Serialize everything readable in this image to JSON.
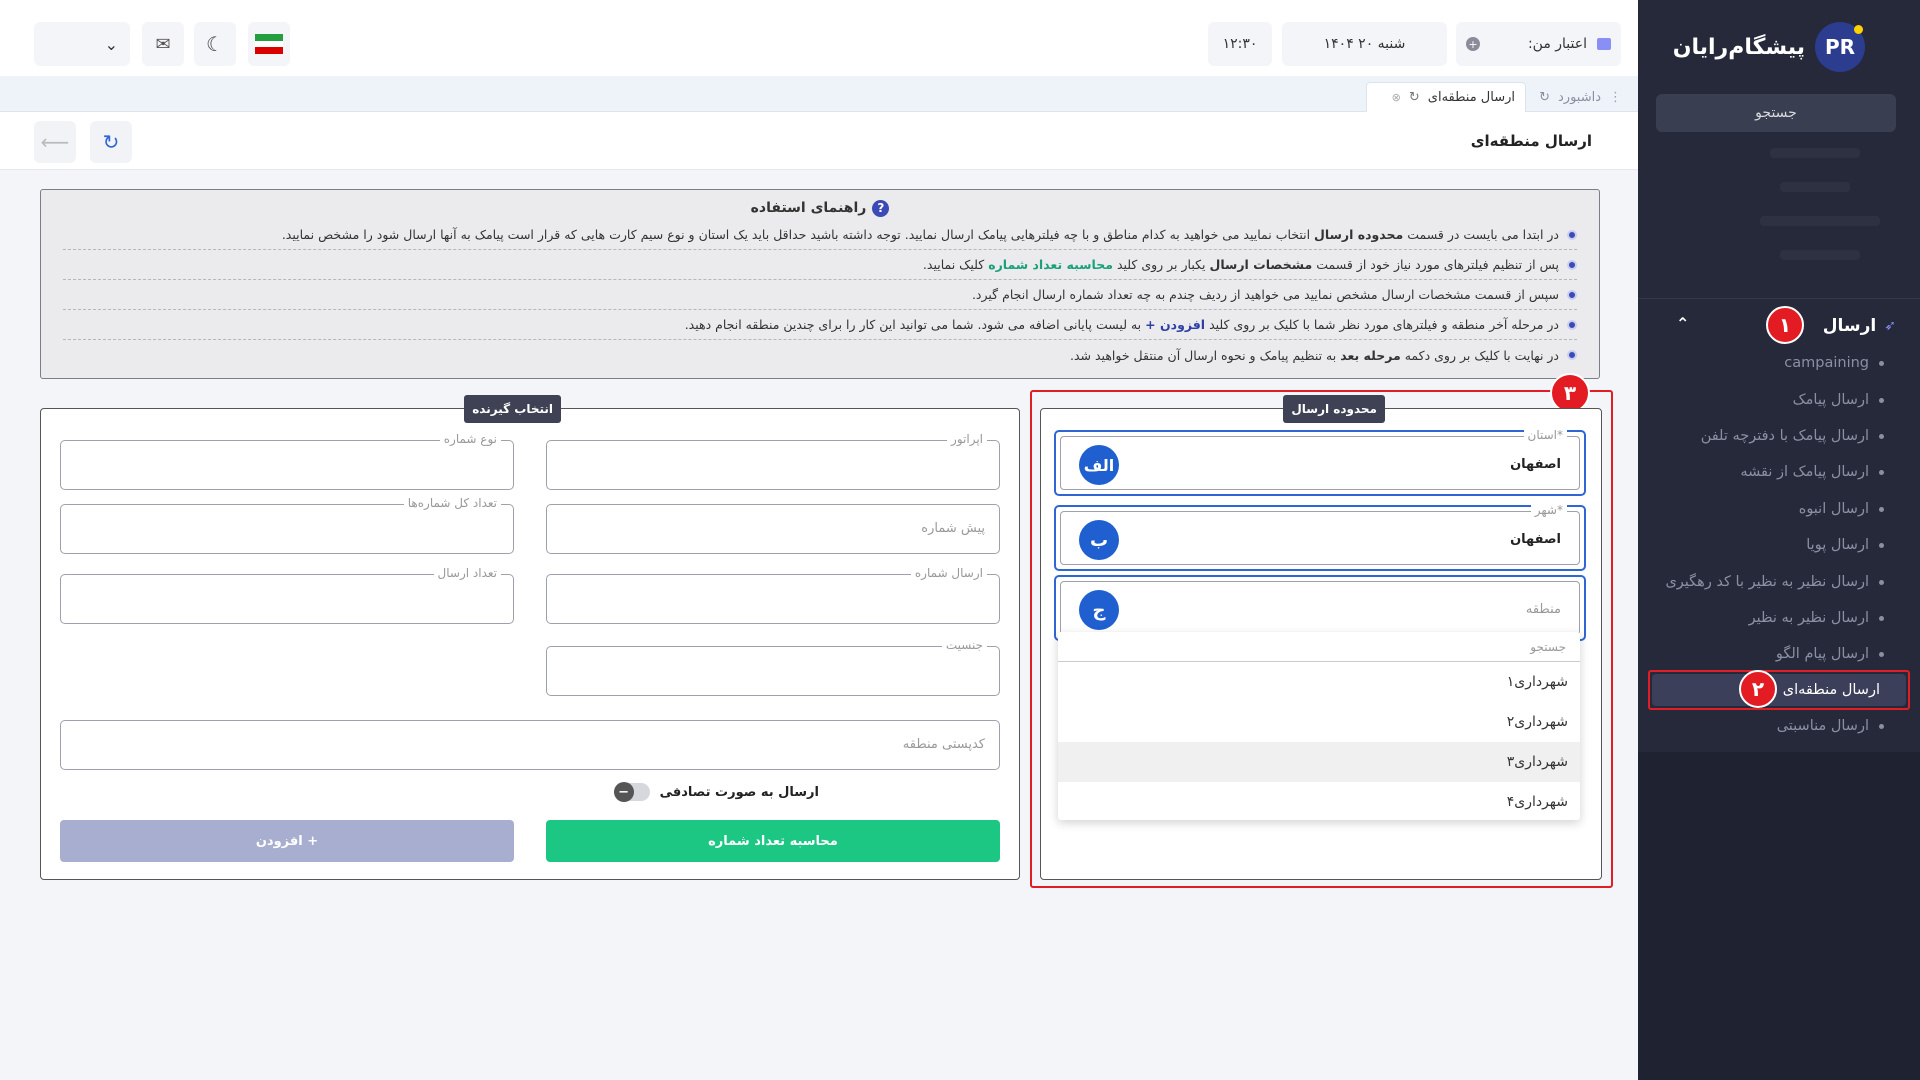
{
  "sidebar": {
    "logo_text": "پیشگام‌رایان",
    "logo_initials": "PR",
    "search_label": "جستجو",
    "section_title": "ارسال",
    "items": [
      "campaining",
      "ارسال پیامک",
      "ارسال پیامک با دفترچه تلفن",
      "ارسال پیامک از نقشه",
      "ارسال انبوه",
      "ارسال پویا",
      "ارسال نظیر به نظیر با کد رهگیری",
      "ارسال نظیر به نظیر",
      "ارسال پیام الگو",
      "ارسال منطقه‌ای",
      "ارسال مناسبتی"
    ],
    "badge_1": "۱",
    "badge_2": "۲"
  },
  "header": {
    "credit_label": "اعتبار من:",
    "date": "شنبه ۲۰ ۱۴۰۴",
    "time": "۱۲:۳۰"
  },
  "tabs": {
    "dashboard": "داشبورد",
    "active": "ارسال منطقه‌ای"
  },
  "page_title": "ارسال منطقه‌ای",
  "guide": {
    "title": "راهنمای استفاده",
    "row1_a": "در ابتدا می بایست در قسمت",
    "row1_b": "محدوده ارسال",
    "row1_c": "انتخاب نمایید می خواهید به کدام مناطق و با چه فیلترهایی پیامک ارسال نمایید. توجه داشته باشید حداقل باید یک استان و نوع سیم کارت هایی که قرار است پیامک به آنها ارسال شود را مشخص نمایید.",
    "row2_a": "پس از تنظیم فیلترهای مورد نیاز خود از قسمت",
    "row2_b": "مشخصات ارسال",
    "row2_c": "یکبار بر روی کلید",
    "row2_d": "محاسبه تعداد شماره",
    "row2_e": "کلیک نمایید.",
    "row3": "سپس از قسمت مشخصات ارسال مشخص نمایید می خواهید از ردیف چندم به چه تعداد شماره ارسال انجام گیرد.",
    "row4_a": "در مرحله آخر منطقه و فیلترهای مورد نظر شما با کلیک بر روی کلید",
    "row4_b": "افزودن +",
    "row4_c": "به لیست پایانی اضافه می شود. شما می توانید این کار را برای چندین منطقه انجام دهید.",
    "row5_a": "در نهایت با کلیک بر روی دکمه",
    "row5_b": "مرحله بعد",
    "row5_c": "به تنظیم پیامک و نحوه ارسال آن منتقل خواهید شد."
  },
  "scope_panel": {
    "label": "محدوده ارسال",
    "badge_3": "۳",
    "province_label": "استان*",
    "province_value": "اصفهان",
    "province_letter": "الف",
    "city_label": "شهر*",
    "city_value": "اصفهان",
    "city_letter": "ب",
    "region_placeholder": "منطقه",
    "region_letter": "ج",
    "dropdown_search": "جستجو",
    "dropdown_options": [
      "شهرداری۱",
      "شهرداری۲",
      "شهرداری۳",
      "شهرداری۴"
    ]
  },
  "recipient_panel": {
    "label": "انتخاب گیرنده",
    "operator_label": "اپراتور",
    "number_type_label": "نوع شماره",
    "prefix_placeholder": "پیش شماره",
    "total_numbers_label": "تعداد کل شماره‌ها",
    "send_number_label": "ارسال شماره",
    "send_count_label": "تعداد ارسال",
    "gender_label": "جنسیت",
    "postal_placeholder": "کدپستی منطقه",
    "random_toggle_label": "ارسال به صورت تصادفی",
    "calc_button": "محاسبه تعداد شماره",
    "add_button": "افزودن +"
  },
  "colors": {
    "sidebar_bg": "#25293a",
    "accent_blue": "#1f5fcf",
    "highlight_red": "#e01e26",
    "green_button": "#1cc784",
    "disabled_button": "#a8aed0"
  }
}
